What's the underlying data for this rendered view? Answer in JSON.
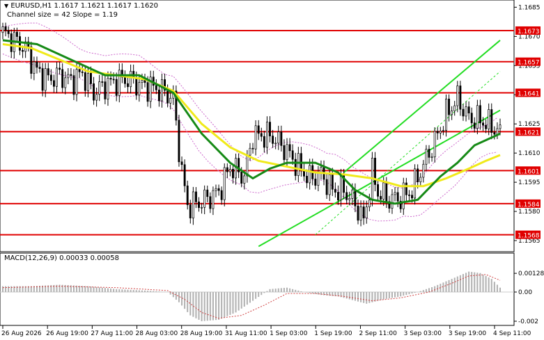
{
  "header": {
    "symbol_line": "EURUSD,H1  1.1617 1.1621 1.1617 1.1620",
    "indicator_line": "Channel size = 42 Slope = 1.19"
  },
  "macd": {
    "label": "MACD(12,26,9) 0.00033 0.00058",
    "ticks": [
      "0.00128",
      "0.00",
      "-0.002"
    ]
  },
  "price_axis": {
    "ticks": [
      "1.1685",
      "1.1670",
      "1.1655",
      "1.1640",
      "1.1625",
      "1.1610",
      "1.1595",
      "1.1580",
      "1.1565"
    ]
  },
  "time_axis": {
    "labels": [
      "26 Aug 2026",
      "26 Aug 19:00",
      "27 Aug 11:00",
      "28 Aug 03:00",
      "28 Aug 19:00",
      "31 Aug 11:00",
      "1 Sep 03:00",
      "1 Sep 19:00",
      "2 Sep 11:00",
      "3 Sep 03:00",
      "3 Sep 19:00",
      "4 Sep 11:00"
    ]
  },
  "levels": [
    "1.1673",
    "1.1657",
    "1.1641",
    "1.1621",
    "1.1601",
    "1.1584",
    "1.1568"
  ],
  "colors": {
    "level_line": "#e00000",
    "level_label_bg": "#e00000",
    "channel": "#22dd22",
    "ma_fast": "#168a16",
    "ma_slow": "#f0ea1a",
    "envelope": "#cc66cc",
    "macd_hist": "#b0b0b0",
    "macd_signal": "#d04040",
    "candles": "#000000"
  },
  "chart_data": {
    "type": "candlestick",
    "symbol": "EURUSD",
    "timeframe": "H1",
    "last_ohlc": {
      "open": 1.1617,
      "high": 1.1621,
      "low": 1.1617,
      "close": 1.162
    },
    "ylim": [
      1.156,
      1.1688
    ],
    "horizontal_levels": [
      1.1673,
      1.1657,
      1.1641,
      1.1621,
      1.1601,
      1.1584,
      1.1568
    ],
    "close_path": [
      [
        0,
        1.1672
      ],
      [
        4,
        1.1668
      ],
      [
        8,
        1.1664
      ],
      [
        12,
        1.1652
      ],
      [
        16,
        1.1648
      ],
      [
        20,
        1.165
      ],
      [
        24,
        1.1647
      ],
      [
        28,
        1.1651
      ],
      [
        32,
        1.1641
      ],
      [
        36,
        1.1645
      ],
      [
        40,
        1.1647
      ],
      [
        44,
        1.1648
      ],
      [
        48,
        1.1645
      ],
      [
        52,
        1.1644
      ],
      [
        56,
        1.1642
      ],
      [
        60,
        1.1638
      ],
      [
        63,
        1.16
      ],
      [
        65,
        1.1583
      ],
      [
        70,
        1.1585
      ],
      [
        76,
        1.159
      ],
      [
        80,
        1.1603
      ],
      [
        85,
        1.1598
      ],
      [
        88,
        1.1619
      ],
      [
        94,
        1.1619
      ],
      [
        96,
        1.1617
      ],
      [
        100,
        1.1611
      ],
      [
        104,
        1.1603
      ],
      [
        108,
        1.1597
      ],
      [
        112,
        1.1599
      ],
      [
        116,
        1.1591
      ],
      [
        120,
        1.1591
      ],
      [
        124,
        1.1584
      ],
      [
        127,
        1.1575
      ],
      [
        130,
        1.16
      ],
      [
        132,
        1.159
      ],
      [
        136,
        1.1586
      ],
      [
        140,
        1.1587
      ],
      [
        144,
        1.1591
      ],
      [
        148,
        1.1604
      ],
      [
        152,
        1.1616
      ],
      [
        156,
        1.163
      ],
      [
        160,
        1.1638
      ],
      [
        164,
        1.1628
      ],
      [
        168,
        1.1627
      ],
      [
        172,
        1.1624
      ],
      [
        175,
        1.162
      ]
    ],
    "ma_fast": [
      [
        0,
        1.1668
      ],
      [
        12,
        1.1666
      ],
      [
        24,
        1.1658
      ],
      [
        36,
        1.165
      ],
      [
        48,
        1.165
      ],
      [
        60,
        1.1641
      ],
      [
        70,
        1.162
      ],
      [
        80,
        1.1605
      ],
      [
        88,
        1.1597
      ],
      [
        94,
        1.1602
      ],
      [
        100,
        1.1605
      ],
      [
        110,
        1.1605
      ],
      [
        118,
        1.16
      ],
      [
        124,
        1.1591
      ],
      [
        130,
        1.1586
      ],
      [
        138,
        1.1584
      ],
      [
        146,
        1.1586
      ],
      [
        154,
        1.1598
      ],
      [
        160,
        1.1605
      ],
      [
        166,
        1.1614
      ],
      [
        175,
        1.162
      ]
    ],
    "ma_slow": [
      [
        0,
        1.1666
      ],
      [
        10,
        1.1664
      ],
      [
        20,
        1.1658
      ],
      [
        30,
        1.1652
      ],
      [
        40,
        1.165
      ],
      [
        50,
        1.1648
      ],
      [
        60,
        1.1642
      ],
      [
        70,
        1.1625
      ],
      [
        80,
        1.1613
      ],
      [
        90,
        1.1606
      ],
      [
        100,
        1.1603
      ],
      [
        110,
        1.16
      ],
      [
        120,
        1.1599
      ],
      [
        130,
        1.1597
      ],
      [
        140,
        1.1593
      ],
      [
        148,
        1.1593
      ],
      [
        156,
        1.1597
      ],
      [
        164,
        1.1602
      ],
      [
        170,
        1.1606
      ],
      [
        175,
        1.1609
      ]
    ],
    "channel": {
      "lower": [
        [
          90,
          1.1562
        ],
        [
          175,
          1.1632
        ]
      ],
      "upper": [
        [
          120,
          1.16
        ],
        [
          175,
          1.1668
        ]
      ],
      "mid": [
        [
          110,
          1.1568
        ],
        [
          175,
          1.1652
        ]
      ]
    },
    "macd": {
      "main": 0.00033,
      "signal": 0.00058,
      "histogram": [
        [
          0,
          0.0004
        ],
        [
          10,
          0.0004
        ],
        [
          20,
          0.0005
        ],
        [
          30,
          0.0004
        ],
        [
          40,
          0.0002
        ],
        [
          50,
          0.0001
        ],
        [
          58,
          0.0
        ],
        [
          62,
          -0.0007
        ],
        [
          66,
          -0.0016
        ],
        [
          70,
          -0.002
        ],
        [
          76,
          -0.0019
        ],
        [
          82,
          -0.0014
        ],
        [
          88,
          -0.0006
        ],
        [
          94,
          0.0002
        ],
        [
          100,
          0.0003
        ],
        [
          106,
          0.0
        ],
        [
          112,
          -0.0002
        ],
        [
          118,
          -0.0003
        ],
        [
          124,
          -0.0006
        ],
        [
          128,
          -0.0008
        ],
        [
          134,
          -0.0005
        ],
        [
          140,
          -0.0003
        ],
        [
          146,
          0.0
        ],
        [
          152,
          0.0004
        ],
        [
          158,
          0.0009
        ],
        [
          164,
          0.0014
        ],
        [
          168,
          0.0013
        ],
        [
          172,
          0.0009
        ],
        [
          175,
          0.0003
        ]
      ],
      "signal_line": [
        [
          0,
          0.0003
        ],
        [
          20,
          0.0004
        ],
        [
          40,
          0.0003
        ],
        [
          58,
          0.0001
        ],
        [
          64,
          -0.0005
        ],
        [
          70,
          -0.0014
        ],
        [
          76,
          -0.0018
        ],
        [
          84,
          -0.0016
        ],
        [
          92,
          -0.0009
        ],
        [
          100,
          -0.0001
        ],
        [
          110,
          -0.0001
        ],
        [
          120,
          -0.0003
        ],
        [
          130,
          -0.0006
        ],
        [
          140,
          -0.0004
        ],
        [
          150,
          0.0
        ],
        [
          158,
          0.0006
        ],
        [
          164,
          0.0011
        ],
        [
          170,
          0.0012
        ],
        [
          175,
          0.0008
        ]
      ]
    }
  }
}
